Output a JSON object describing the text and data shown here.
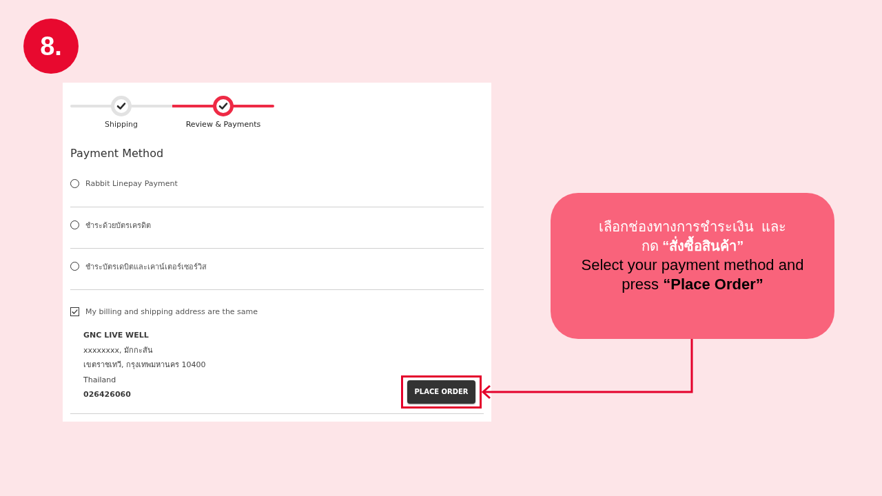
{
  "step_badge": {
    "label": "8."
  },
  "screenshot": {
    "stepper": {
      "steps": [
        {
          "label": "Shipping",
          "selected": false
        },
        {
          "label": "Review & Payments",
          "selected": true
        }
      ]
    },
    "payment_method": {
      "title": "Payment Method",
      "options": [
        {
          "label": "Rabbit Linepay Payment",
          "selected": false
        },
        {
          "label": "ชำระด้วยบัตรเครดิต",
          "selected": false
        },
        {
          "label": "ชำระบัตรเดบิตและเคาน์เตอร์เซอร์วิส",
          "selected": false
        }
      ]
    },
    "billing_same_as_shipping": {
      "label": "My billing and shipping address are the same",
      "checked": true
    },
    "address": {
      "name": "GNC LIVE WELL",
      "lines": [
        "xxxxxxxx, มักกะสัน",
        "เขตราชเทวี, กรุงเทพมหานคร 10400",
        "Thailand"
      ],
      "phone": "026426060"
    },
    "place_order_button": {
      "label": "PLACE ORDER",
      "highlighted": true
    }
  },
  "callout": {
    "thai_lines": [
      "เลือกช่องทางการชำระเงิน  และ",
      "กด **“สั่งซื้อสินค้า”**"
    ],
    "english_lines": [
      "Select your payment method and",
      "press **“Place Order”**"
    ]
  }
}
